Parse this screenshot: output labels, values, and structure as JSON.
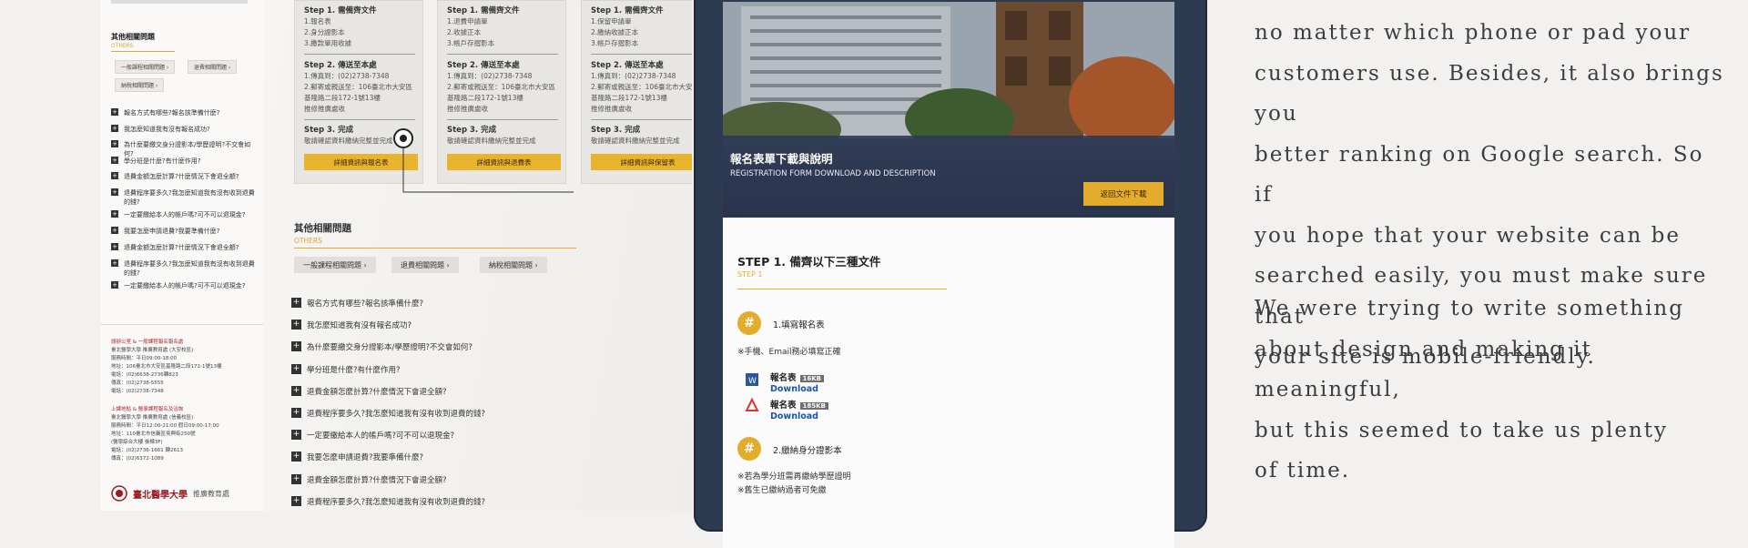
{
  "left": {
    "others_title": "其他相關問題",
    "others_sub": "OTHERS",
    "chips": [
      "一般課程相關問題 ›",
      "退費相關問題 ›",
      "納稅相關問題 ›"
    ],
    "faqs": [
      "報名方式有哪些?報名該準備什麼?",
      "我怎麼知道我有沒有報名成功?",
      "為什麼要繳交身分證影本/學歷證明?不交會如何?",
      "學分班是什麼?有什麼作用?",
      "退費金額怎麼計算?什麼情況下會退全額?",
      "退費程序要多久?我怎麼知道我有沒有收到退費的錢?",
      "一定要繳給本人的帳戶嗎?可不可以退現金?",
      "我要怎麼申請退費?我要準備什麼?",
      "退費金額怎麼計算?什麼情況下會退全額?",
      "退費程序要多久?我怎麼知道我有沒有收到退費的錢?",
      "一定要繳給本人的帳戶嗎?可不可以退現金?"
    ],
    "footer_lines_1": [
      "總辦公室 & 一般課程報名報名處",
      "臺北醫學大學 推廣教育處 (大安校區)",
      "服務時間：平日09:00-18:00",
      "地址：106臺北市大安區基隆路二段172-1號13樓",
      "電話：(02)6638-2736轉823",
      "傳真：(02)2738-5555",
      "電話：(02)2738-7348"
    ],
    "footer_lines_2": [
      "上課地點 & 醫事課程報名及洽詢",
      "臺北醫學大學 推廣教育處 (信義校區)",
      "服務時間：平日12:00-21:00 假日09:00-17:00",
      "地址：110臺北市信義區吳興街250號",
      "(醫學綜合大樓 後棟3F)",
      "電話：(02)2736-1661 轉2613",
      "傳真：(02)6372-1089"
    ],
    "logo_text": "臺北醫學大學",
    "logo_sub": "推廣教育處"
  },
  "cards": [
    {
      "step1": "Step 1. 需備齊文件",
      "items": [
        "1.報名表",
        "2.身分證影本",
        "3.繳款單用收據"
      ],
      "step2": "Step 2. 傳送至本處",
      "addr": [
        "1.傳真到：(02)2738-7348",
        "2.郵寄或親送至：106臺北市大安區",
        "基隆路二段172-1號13樓",
        "推修推廣處收"
      ],
      "step3": "Step 3. 完成",
      "done": "敬請確認資料繳納完整並完成",
      "button": "詳細資訊與報名表"
    },
    {
      "step1": "Step 1. 需備齊文件",
      "items": [
        "1.退費申請單",
        "2.收據正本",
        "3.帳戶存摺影本"
      ],
      "step2": "Step 2. 傳送至本處",
      "addr": [
        "1.傳真到：(02)2738-7348",
        "2.郵寄或親送至：106臺北市大安區",
        "基隆路二段172-1號13樓",
        "推修推廣處收"
      ],
      "step3": "Step 3. 完成",
      "done": "敬請確認資料繳納完整並完成",
      "button": "詳細資訊與退費表"
    },
    {
      "step1": "Step 1. 需備齊文件",
      "items": [
        "1.保留申請單",
        "2.繳納收據正本",
        "3.帳戶存摺影本"
      ],
      "step2": "Step 2. 傳送至本處",
      "addr": [
        "1.傳真到：(02)2738-7348",
        "2.郵寄或親送至：106臺北市大安區",
        "基隆路二段172-1號13樓",
        "推修推廣處收"
      ],
      "step3": "Step 3. 完成",
      "done": "敬請確認資料繳納完整並完成",
      "button": "詳細資訊與保留表"
    }
  ],
  "mid": {
    "others_title": "其他相關問題",
    "others_sub": "OTHERS",
    "chips": [
      "一般課程相關問題 ›",
      "退費相關問題 ›",
      "納稅相關問題 ›"
    ],
    "faqs": [
      "報名方式有哪些?報名該準備什麼?",
      "我怎麼知道我有沒有報名成功?",
      "為什麼要繳交身分證影本/學歷證明?不交會如何?",
      "學分班是什麼?有什麼作用?",
      "退費金額怎麼計算?什麼情況下會退全額?",
      "退費程序要多久?我怎麼知道我有沒有收到退費的錢?",
      "一定要繳給本人的帳戶嗎?可不可以退現金?",
      "我要怎麼申請退費?我要準備什麼?",
      "退費金額怎麼計算?什麼情況下會退全額?",
      "退費程序要多久?我怎麼知道我有沒有收到退費的錢?"
    ]
  },
  "tablet": {
    "hero_title": "報名表單下載與說明",
    "hero_sub": "REGISTRATION FORM DOWNLOAD AND DESCRIPTION",
    "hero_button": "返回文件下載",
    "step_title": "STEP 1. 備齊以下三種文件",
    "step_sub": "STEP 1",
    "item1_num": "#",
    "item1_title": "1.填寫報名表",
    "item1_note": "※手機、Email務必填寫正確",
    "files": [
      {
        "name": "報名表",
        "size": "16KB",
        "link": "Download",
        "ext": "DOCX"
      },
      {
        "name": "報名表",
        "size": "185KB",
        "link": "Download",
        "ext": "PDF"
      }
    ],
    "item2_num": "#",
    "item2_title": "2.繳納身分證影本",
    "item2_notes": [
      "※若為學分班需再繳納學歷證明",
      "※舊生已繳納過者可免繳"
    ]
  },
  "prose": {
    "para1": [
      "no matter which phone or pad your",
      "customers use. Besides, it also brings you",
      "better ranking on Google search. So if",
      "you hope that your website can be",
      "searched easily, you must make sure that",
      "your site is mobile-friendly."
    ],
    "para2": [
      "We were trying to write something",
      "about design and making it meaningful,",
      "but this seemed to take us plenty",
      "of time."
    ]
  },
  "colors": {
    "accent": "#e4ac2c",
    "tablet_frame": "#2c3b52",
    "link": "#1a55a8",
    "text": "#3d3d3d"
  }
}
